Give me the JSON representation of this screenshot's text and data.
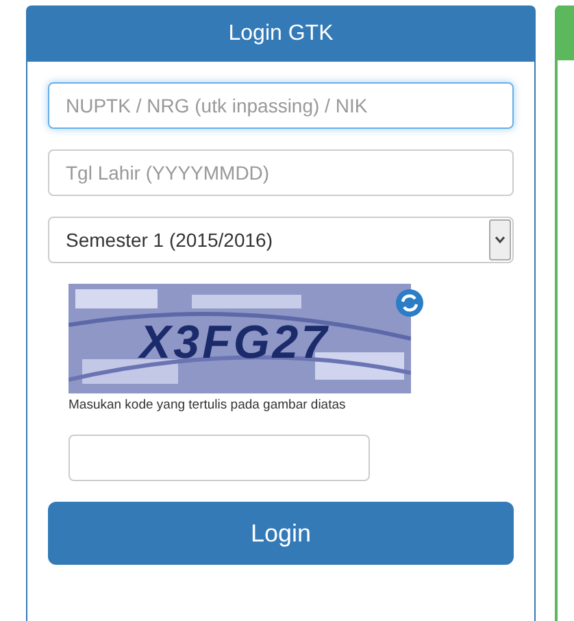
{
  "panel": {
    "title": "Login GTK"
  },
  "id_field": {
    "placeholder": "NUPTK / NRG (utk inpassing) / NIK",
    "focused": true
  },
  "birth_field": {
    "placeholder": "Tgl Lahir (YYYYMMDD)"
  },
  "semester_select": {
    "value": "Semester 1 (2015/2016)"
  },
  "captcha": {
    "code": "X3FG27",
    "hint": "Masukan kode yang tertulis pada gambar diatas"
  },
  "login_button": {
    "label": "Login"
  }
}
